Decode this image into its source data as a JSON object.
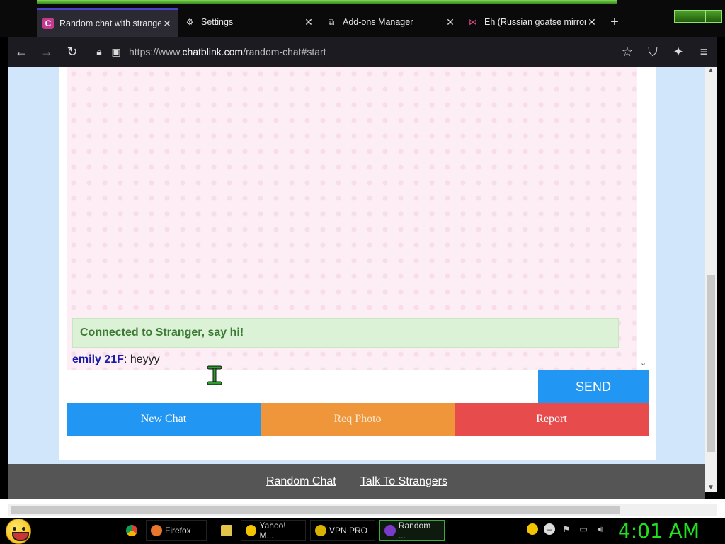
{
  "tabs": [
    {
      "label": "Random chat with strange",
      "icon": "chatblink-favicon",
      "active": true
    },
    {
      "label": "Settings",
      "icon": "gear-icon"
    },
    {
      "label": "Add-ons Manager",
      "icon": "puzzle-icon"
    },
    {
      "label": "Eh (Russian goatse mirror)",
      "icon": "butterfly-icon"
    }
  ],
  "urlbar": {
    "prefix": "https://www.",
    "domain": "chatblink.com",
    "path": "/random-chat#start"
  },
  "chat": {
    "system_message": "Connected to Stranger, say hi!",
    "lines": [
      {
        "nick": "emily 21F",
        "text": ": heyyy"
      }
    ],
    "input_value": "",
    "send_label": "SEND"
  },
  "actions": {
    "new_chat": "New Chat",
    "req_photo": "Req Photo",
    "report": "Report"
  },
  "footer": {
    "random_chat": "Random Chat",
    "talk_to_strangers": "Talk To Strangers"
  },
  "taskbar": {
    "items": [
      {
        "label": "Firefox",
        "color": "#e8762d"
      },
      {
        "label": "Yahoo! M...",
        "color": "#f4c400"
      },
      {
        "label": "VPN PRO",
        "color": "#d9b300"
      },
      {
        "label": "Random ...",
        "color": "#7a3cc8"
      }
    ],
    "clock": "4:01 AM"
  },
  "colors": {
    "send": "#2196f3",
    "new_chat": "#2196f3",
    "req_photo": "#f0963a",
    "report": "#e84b4b",
    "clock": "#20e020"
  }
}
